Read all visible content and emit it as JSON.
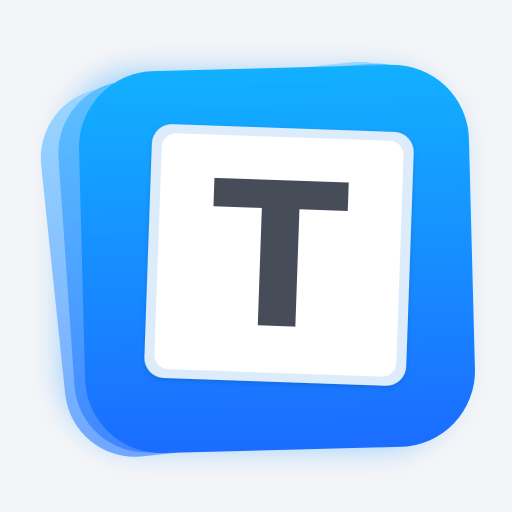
{
  "icon": {
    "name": "text-tile-app-icon",
    "letter": "T",
    "colors": {
      "background": "#f4f5f7",
      "stack_back": "#7ec4ff",
      "stack_middle": "#4aa6ff",
      "front_gradient_top": "#12b0ff",
      "front_gradient_bottom": "#1b6cff",
      "tile_border": "#dcecfb",
      "tile_face": "#ffffff",
      "letter": "#464d59"
    }
  }
}
